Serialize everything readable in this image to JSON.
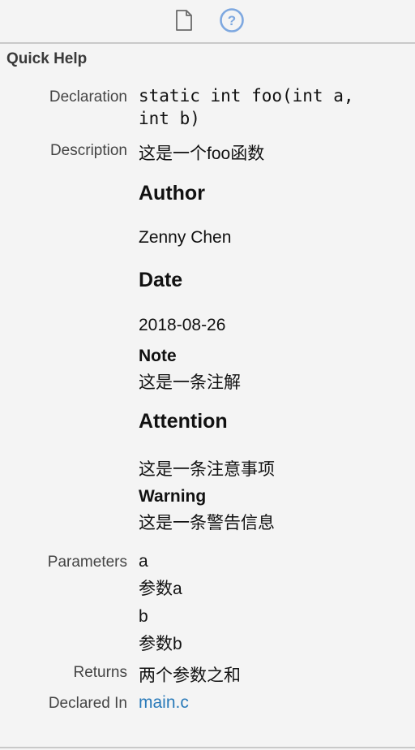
{
  "toolbar": {
    "file_icon": "file-document-icon",
    "help_icon": "question-circle-icon",
    "help_accent": "#7ea8e0"
  },
  "panel": {
    "title": "Quick Help"
  },
  "declaration": {
    "label": "Declaration",
    "line1": "static int foo(int a,",
    "line2": "int b)"
  },
  "description": {
    "label": "Description",
    "text": "这是一个foo函数",
    "author_heading": "Author",
    "author_value": "Zenny Chen",
    "date_heading": "Date",
    "date_value": "2018-08-26",
    "note_heading": "Note",
    "note_value": "这是一条注解",
    "attention_heading": "Attention",
    "attention_value": "这是一条注意事项",
    "warning_heading": "Warning",
    "warning_value": "这是一条警告信息"
  },
  "parameters": {
    "label": "Parameters",
    "items": [
      {
        "name": "a",
        "desc": "参数a"
      },
      {
        "name": "b",
        "desc": "参数b"
      }
    ]
  },
  "returns": {
    "label": "Returns",
    "text": "两个参数之和"
  },
  "declared_in": {
    "label": "Declared In",
    "file": "main.c",
    "link_color": "#2a7ab9"
  }
}
